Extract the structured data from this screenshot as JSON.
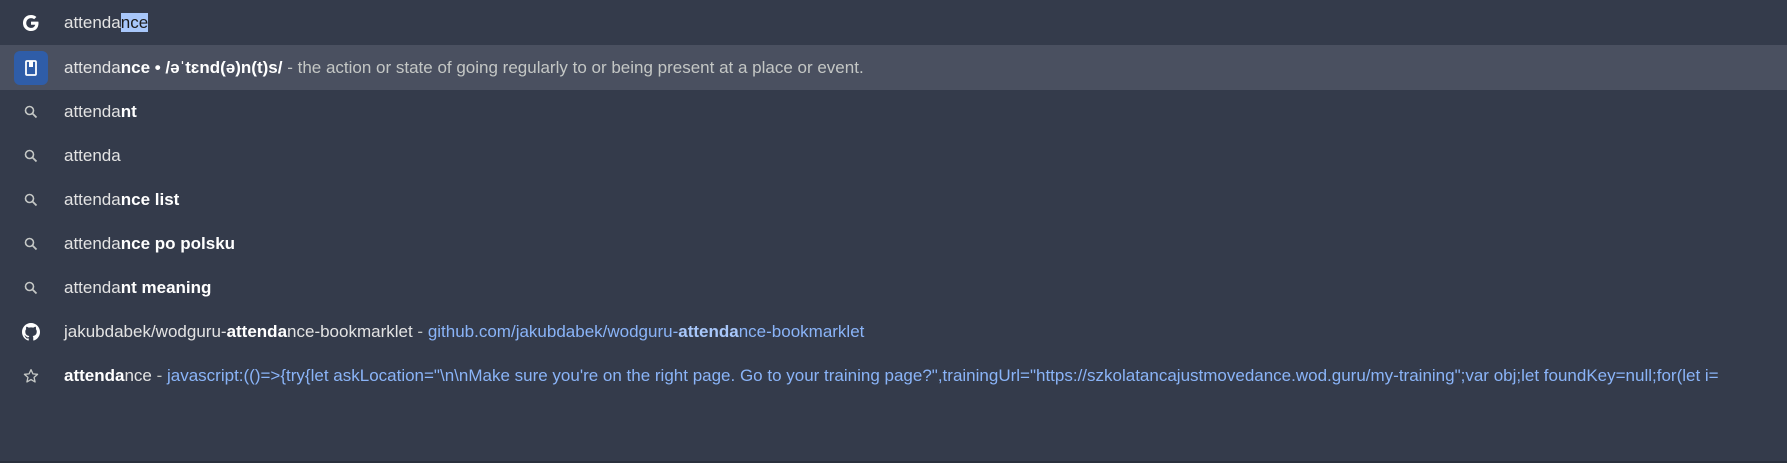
{
  "input": {
    "typed": "attenda",
    "autocompleted": "nce"
  },
  "suggestions": [
    {
      "type": "dictionary",
      "icon": "dictionary-icon",
      "normal": "attenda",
      "bold": "nce",
      "phonetic": " • /əˈtɛnd(ə)n(t)s/",
      "separator": " - ",
      "definition": "the action or state of going regularly to or being present at a place or event."
    },
    {
      "type": "search",
      "icon": "search-icon",
      "normal": "attenda",
      "bold": "nt"
    },
    {
      "type": "search",
      "icon": "search-icon",
      "normal": "attenda",
      "bold": ""
    },
    {
      "type": "search",
      "icon": "search-icon",
      "normal": "attenda",
      "bold": "nce list"
    },
    {
      "type": "search",
      "icon": "search-icon",
      "normal": "attenda",
      "bold": "nce po polsku"
    },
    {
      "type": "search",
      "icon": "search-icon",
      "normal": "attenda",
      "bold": "nt meaning"
    },
    {
      "type": "history",
      "icon": "github-icon",
      "title_pre": "jakubdabek/wodguru-",
      "title_bold": "attenda",
      "title_post": "nce-bookmarklet",
      "separator": " - ",
      "url_pre": "github.com/jakubdabek/wodguru-",
      "url_bold": "attenda",
      "url_post": "nce-bookmarklet"
    },
    {
      "type": "bookmark",
      "icon": "star-icon",
      "title_bold": "attenda",
      "title_post": "nce",
      "separator": " - ",
      "url": "javascript:(()=>{try{let askLocation=\"\\n\\nMake sure you're on the right page. Go to your training page?\",trainingUrl=\"https://szkolatancajustmovedance.wod.guru/my-training\";var obj;let foundKey=null;for(let i="
    }
  ],
  "colors": {
    "background": "#343b4b",
    "selected_row": "#4a5060",
    "url": "#8ab4f8",
    "highlight": "#a8c7fa"
  }
}
